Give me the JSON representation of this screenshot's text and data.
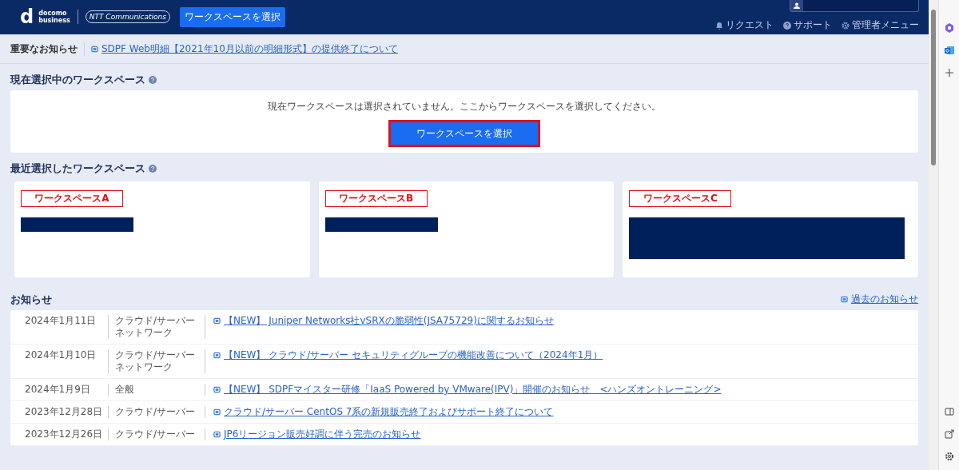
{
  "header": {
    "logo": {
      "mark": "d",
      "line1": "docomo",
      "line2": "business",
      "partner": "NTT Communications"
    },
    "workspace_button": "ワークスペースを選択",
    "links": [
      {
        "kind": "bell",
        "label": "リクエスト"
      },
      {
        "kind": "help",
        "label": "サポート"
      },
      {
        "kind": "gear",
        "label": "管理者メニュー"
      }
    ]
  },
  "important_notice": {
    "label": "重要なお知らせ",
    "link": "SDPF Web明細【2021年10月以前の明細形式】の提供終了について"
  },
  "current_workspace": {
    "title": "現在選択中のワークスペース",
    "message": "現在ワークスペースは選択されていません。ここからワークスペースを選択してください。",
    "button": "ワークスペースを選択"
  },
  "recent_workspaces": {
    "title": "最近選択したワークスペース",
    "cards": [
      {
        "label": "ワークスペースA",
        "kind": "short"
      },
      {
        "label": "ワークスペースB",
        "kind": "short"
      },
      {
        "label": "ワークスペースC",
        "kind": "tall"
      }
    ]
  },
  "news": {
    "title": "お知らせ",
    "archive_link": "過去のお知らせ",
    "rows": [
      {
        "date": "2024年1月11日",
        "category": [
          "クラウド/サーバー",
          "ネットワーク"
        ],
        "title": "【NEW】 Juniper Networks社vSRXの脆弱性(JSA75729)に関するお知らせ"
      },
      {
        "date": "2024年1月10日",
        "category": [
          "クラウド/サーバー",
          "ネットワーク"
        ],
        "title": "【NEW】 クラウド/サーバー セキュリティグループの機能改善について（2024年1月）"
      },
      {
        "date": "2024年1月9日",
        "category": [
          "全般"
        ],
        "title": "【NEW】 SDPFマイスター研修「IaaS Powered by VMware(IPV)」開催のお知らせ　<ハンズオントレーニング>"
      },
      {
        "date": "2023年12月28日",
        "category": [
          "クラウド/サーバー"
        ],
        "title": "クラウド/サーバー CentOS 7系の新規販売終了およびサポート終了について"
      },
      {
        "date": "2023年12月26日",
        "category": [
          "クラウド/サーバー"
        ],
        "title": "JP6リージョン販売好調に伴う完売のお知らせ"
      }
    ]
  }
}
